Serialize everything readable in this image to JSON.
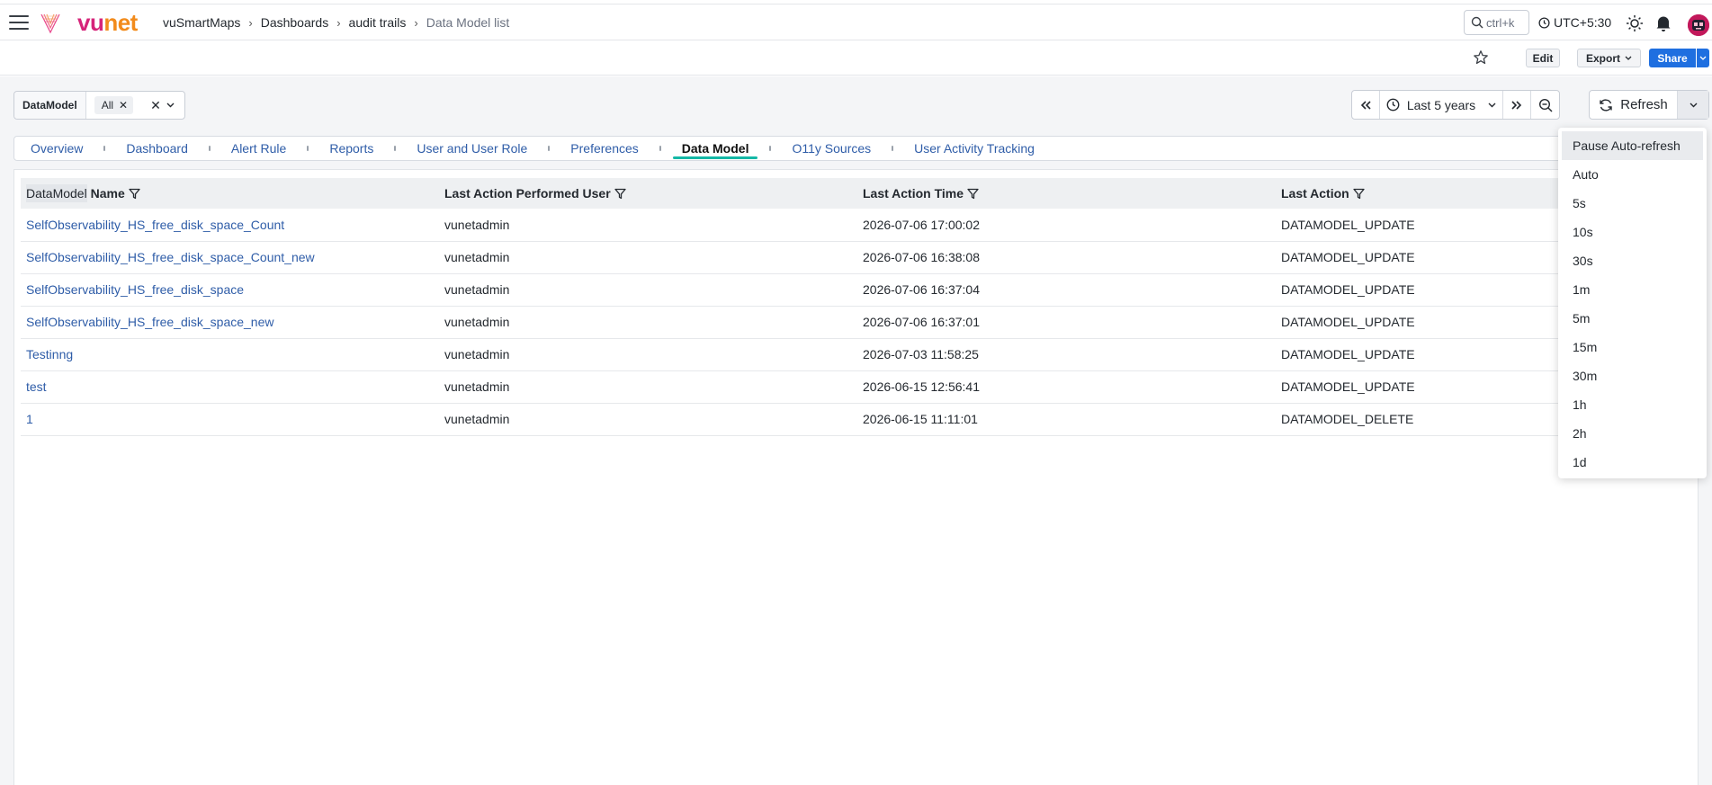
{
  "header": {
    "brand_vu": "vu",
    "brand_net": "net",
    "breadcrumbs": [
      "vuSmartMaps",
      "Dashboards",
      "audit trails",
      "Data Model list"
    ],
    "search_label": "ctrl+k",
    "timezone": "UTC+5:30"
  },
  "toolbar": {
    "edit_label": "Edit",
    "export_label": "Export",
    "share_label": "Share"
  },
  "filter": {
    "label": "DataModel",
    "chip": "All"
  },
  "time_range": {
    "label": "Last 5 years",
    "refresh_label": "Refresh"
  },
  "tabs": [
    {
      "label": "Overview",
      "active": false
    },
    {
      "label": "Dashboard",
      "active": false
    },
    {
      "label": "Alert Rule",
      "active": false
    },
    {
      "label": "Reports",
      "active": false
    },
    {
      "label": "User and User Role",
      "active": false
    },
    {
      "label": "Preferences",
      "active": false
    },
    {
      "label": "Data Model",
      "active": true
    },
    {
      "label": "O11y Sources",
      "active": false
    },
    {
      "label": "User Activity Tracking",
      "active": false
    }
  ],
  "table": {
    "col1_prefix": "DataModel",
    "col1_suffix": " Name",
    "col2": "Last Action Performed User",
    "col3": "Last Action Time",
    "col4": "Last Action",
    "rows": [
      {
        "name": "SelfObservability_HS_free_disk_space_Count",
        "user": "vunetadmin",
        "time": "2026-07-06 17:00:02",
        "action": "DATAMODEL_UPDATE"
      },
      {
        "name": "SelfObservability_HS_free_disk_space_Count_new",
        "user": "vunetadmin",
        "time": "2026-07-06 16:38:08",
        "action": "DATAMODEL_UPDATE"
      },
      {
        "name": "SelfObservability_HS_free_disk_space",
        "user": "vunetadmin",
        "time": "2026-07-06 16:37:04",
        "action": "DATAMODEL_UPDATE"
      },
      {
        "name": "SelfObservability_HS_free_disk_space_new",
        "user": "vunetadmin",
        "time": "2026-07-06 16:37:01",
        "action": "DATAMODEL_UPDATE"
      },
      {
        "name": "Testinng",
        "user": "vunetadmin",
        "time": "2026-07-03 11:58:25",
        "action": "DATAMODEL_UPDATE"
      },
      {
        "name": "test",
        "user": "vunetadmin",
        "time": "2026-06-15 12:56:41",
        "action": "DATAMODEL_UPDATE"
      },
      {
        "name": "1",
        "user": "vunetadmin",
        "time": "2026-06-15 11:11:01",
        "action": "DATAMODEL_DELETE"
      }
    ]
  },
  "refresh_menu": [
    "Pause Auto-refresh",
    "Auto",
    "5s",
    "10s",
    "30s",
    "1m",
    "5m",
    "15m",
    "30m",
    "1h",
    "2h",
    "1d"
  ],
  "colors": {
    "brand_pink": "#d6247a",
    "brand_orange": "#f28b1c",
    "link": "#2f5da8",
    "share": "#1f6fe0",
    "tab_underline": "#14b8a6"
  }
}
